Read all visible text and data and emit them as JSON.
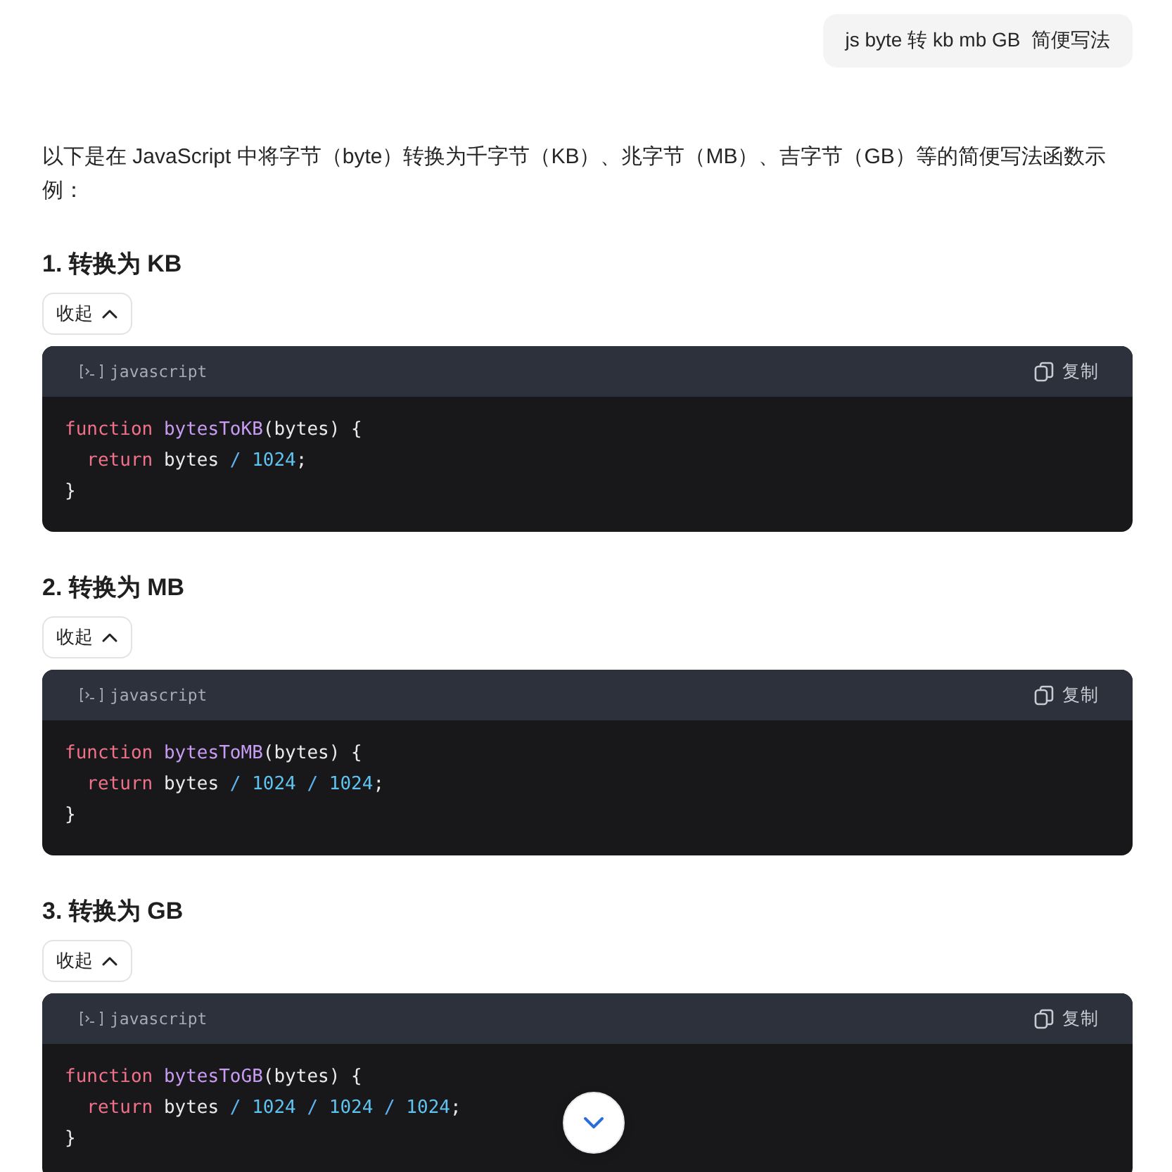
{
  "user_message": {
    "text": "js byte 转 kb mb GB  简便写法"
  },
  "intro": "以下是在 JavaScript 中将字节（byte）转换为千字节（KB）、兆字节（MB）、吉字节（GB）等的简便写法函数示例：",
  "sections": [
    {
      "heading": "1. 转换为 KB",
      "toggle": "收起",
      "language": "javascript",
      "copy": "复制",
      "lines": [
        [
          {
            "kind": "keyword",
            "text": "function "
          },
          {
            "kind": "func",
            "text": "bytesToKB"
          },
          {
            "kind": "plain",
            "text": "(bytes) {"
          }
        ],
        [
          {
            "kind": "keyword",
            "text": "  return "
          },
          {
            "kind": "plain",
            "text": "bytes "
          },
          {
            "kind": "op",
            "text": "/ "
          },
          {
            "kind": "num",
            "text": "1024"
          },
          {
            "kind": "plain",
            "text": ";"
          }
        ],
        [
          {
            "kind": "plain",
            "text": "}"
          }
        ]
      ]
    },
    {
      "heading": "2. 转换为 MB",
      "toggle": "收起",
      "language": "javascript",
      "copy": "复制",
      "lines": [
        [
          {
            "kind": "keyword",
            "text": "function "
          },
          {
            "kind": "func",
            "text": "bytesToMB"
          },
          {
            "kind": "plain",
            "text": "(bytes) {"
          }
        ],
        [
          {
            "kind": "keyword",
            "text": "  return "
          },
          {
            "kind": "plain",
            "text": "bytes "
          },
          {
            "kind": "op",
            "text": "/ "
          },
          {
            "kind": "num",
            "text": "1024"
          },
          {
            "kind": "op",
            "text": " / "
          },
          {
            "kind": "num",
            "text": "1024"
          },
          {
            "kind": "plain",
            "text": ";"
          }
        ],
        [
          {
            "kind": "plain",
            "text": "}"
          }
        ]
      ]
    },
    {
      "heading": "3. 转换为 GB",
      "toggle": "收起",
      "language": "javascript",
      "copy": "复制",
      "lines": [
        [
          {
            "kind": "keyword",
            "text": "function "
          },
          {
            "kind": "func",
            "text": "bytesToGB"
          },
          {
            "kind": "plain",
            "text": "(bytes) {"
          }
        ],
        [
          {
            "kind": "keyword",
            "text": "  return "
          },
          {
            "kind": "plain",
            "text": "bytes "
          },
          {
            "kind": "op",
            "text": "/ "
          },
          {
            "kind": "num",
            "text": "1024"
          },
          {
            "kind": "op",
            "text": " / "
          },
          {
            "kind": "num",
            "text": "1024"
          },
          {
            "kind": "op",
            "text": " / "
          },
          {
            "kind": "num",
            "text": "1024"
          },
          {
            "kind": "plain",
            "text": ";"
          }
        ],
        [
          {
            "kind": "plain",
            "text": "}"
          }
        ]
      ]
    }
  ]
}
